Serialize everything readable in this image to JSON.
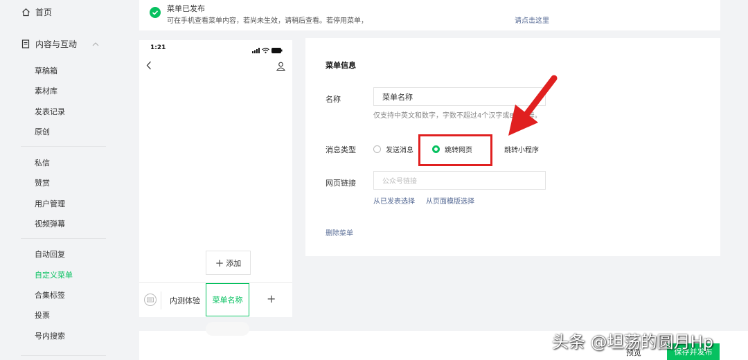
{
  "sidebar": {
    "home": "首页",
    "content_section": "内容与互动",
    "items_a": [
      "草稿箱",
      "素材库",
      "发表记录",
      "原创"
    ],
    "items_b": [
      "私信",
      "赞赏",
      "用户管理",
      "视频弹幕"
    ],
    "items_c": [
      "自动回复",
      "自定义菜单",
      "合集标签",
      "投票",
      "号内搜索"
    ],
    "active_item": "自定义菜单"
  },
  "notice": {
    "title": "菜单已发布",
    "desc": "可在手机查看菜单内容，若尚未生效，请稍后查看。若停用菜单，",
    "link": "请点击这里"
  },
  "phone": {
    "time": "1:21",
    "add_label": "添加",
    "menu_items": [
      "内测体验",
      "菜单名称"
    ]
  },
  "form": {
    "title": "菜单信息",
    "name_label": "名称",
    "name_value": "菜单名称",
    "name_hint": "仅支持中英文和数字，字数不超过4个汉字或8个字母。",
    "type_label": "消息类型",
    "type_options": [
      "发送消息",
      "跳转网页",
      "跳转小程序"
    ],
    "type_selected": "跳转网页",
    "url_label": "网页链接",
    "url_placeholder": "公众号链接",
    "link_published": "从已发表选择",
    "link_template": "从页面模版选择",
    "delete_label": "删除菜单"
  },
  "bottom": {
    "preview": "预览",
    "save": "保存并发布"
  },
  "watermark": "头条 @坦荡的圆月Hp",
  "colors": {
    "accent": "#07c160",
    "link": "#576b95",
    "highlight": "#e02020"
  }
}
